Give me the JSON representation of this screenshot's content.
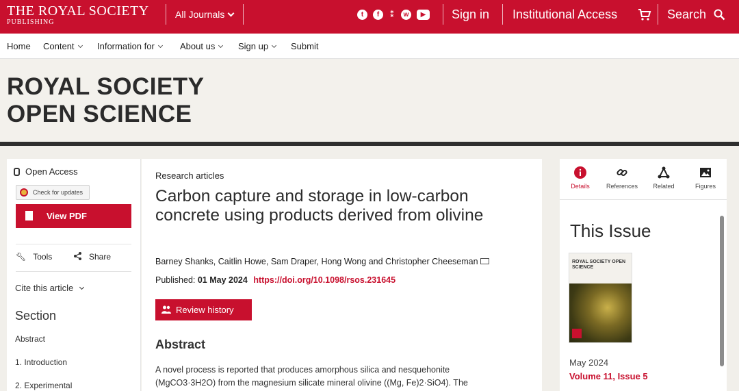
{
  "header": {
    "logo_line1": "THE ROYAL SOCIETY",
    "logo_line2": "PUBLISHING",
    "all_journals": "All Journals",
    "social_icons": [
      "twitter-icon",
      "facebook-icon",
      "orcid-icon",
      "wechat-icon",
      "youtube-icon"
    ],
    "sign_in": "Sign in",
    "institutional_access": "Institutional Access",
    "search": "Search",
    "brand_color": "#c8102e"
  },
  "nav": {
    "items": [
      {
        "label": "Home"
      },
      {
        "label": "Content"
      },
      {
        "label": "Information for"
      },
      {
        "label": "About us"
      },
      {
        "label": "Sign up"
      },
      {
        "label": "Submit"
      }
    ]
  },
  "journal": {
    "title_line1": "ROYAL SOCIETY",
    "title_line2": "OPEN SCIENCE"
  },
  "sidebar": {
    "open_access": "Open Access",
    "check_updates": "Check for updates",
    "view_pdf": "View PDF",
    "tools": "Tools",
    "share": "Share",
    "cite": "Cite this article",
    "section_heading": "Section",
    "sections": [
      "Abstract",
      "1. Introduction",
      "2. Experimental"
    ]
  },
  "article": {
    "category": "Research articles",
    "title": "Carbon capture and storage in low-carbon concrete using products derived from olivine",
    "authors": "Barney Shanks, Caitlin Howe, Sam Draper, Hong Wong and Christopher Cheeseman",
    "published_label": "Published:",
    "published_date": "01 May 2024",
    "doi": "https://doi.org/10.1098/rsos.231645",
    "review_history": "Review history",
    "abstract_heading": "Abstract",
    "abstract_line1": "A novel process is reported that produces amorphous silica and nesquehonite",
    "abstract_line2": "(MgCO3·3H2O) from the magnesium silicate mineral olivine ((Mg, Fe)2·SiO4). The"
  },
  "right_panel": {
    "tabs": [
      {
        "label": "Details",
        "icon": "info-icon"
      },
      {
        "label": "References",
        "icon": "link-icon"
      },
      {
        "label": "Related",
        "icon": "network-icon"
      },
      {
        "label": "Figures",
        "icon": "image-icon"
      }
    ],
    "this_issue": "This Issue",
    "cover_title": "ROYAL SOCIETY OPEN SCIENCE",
    "issue_date": "May 2024",
    "issue_volume": "Volume 11, Issue 5"
  }
}
